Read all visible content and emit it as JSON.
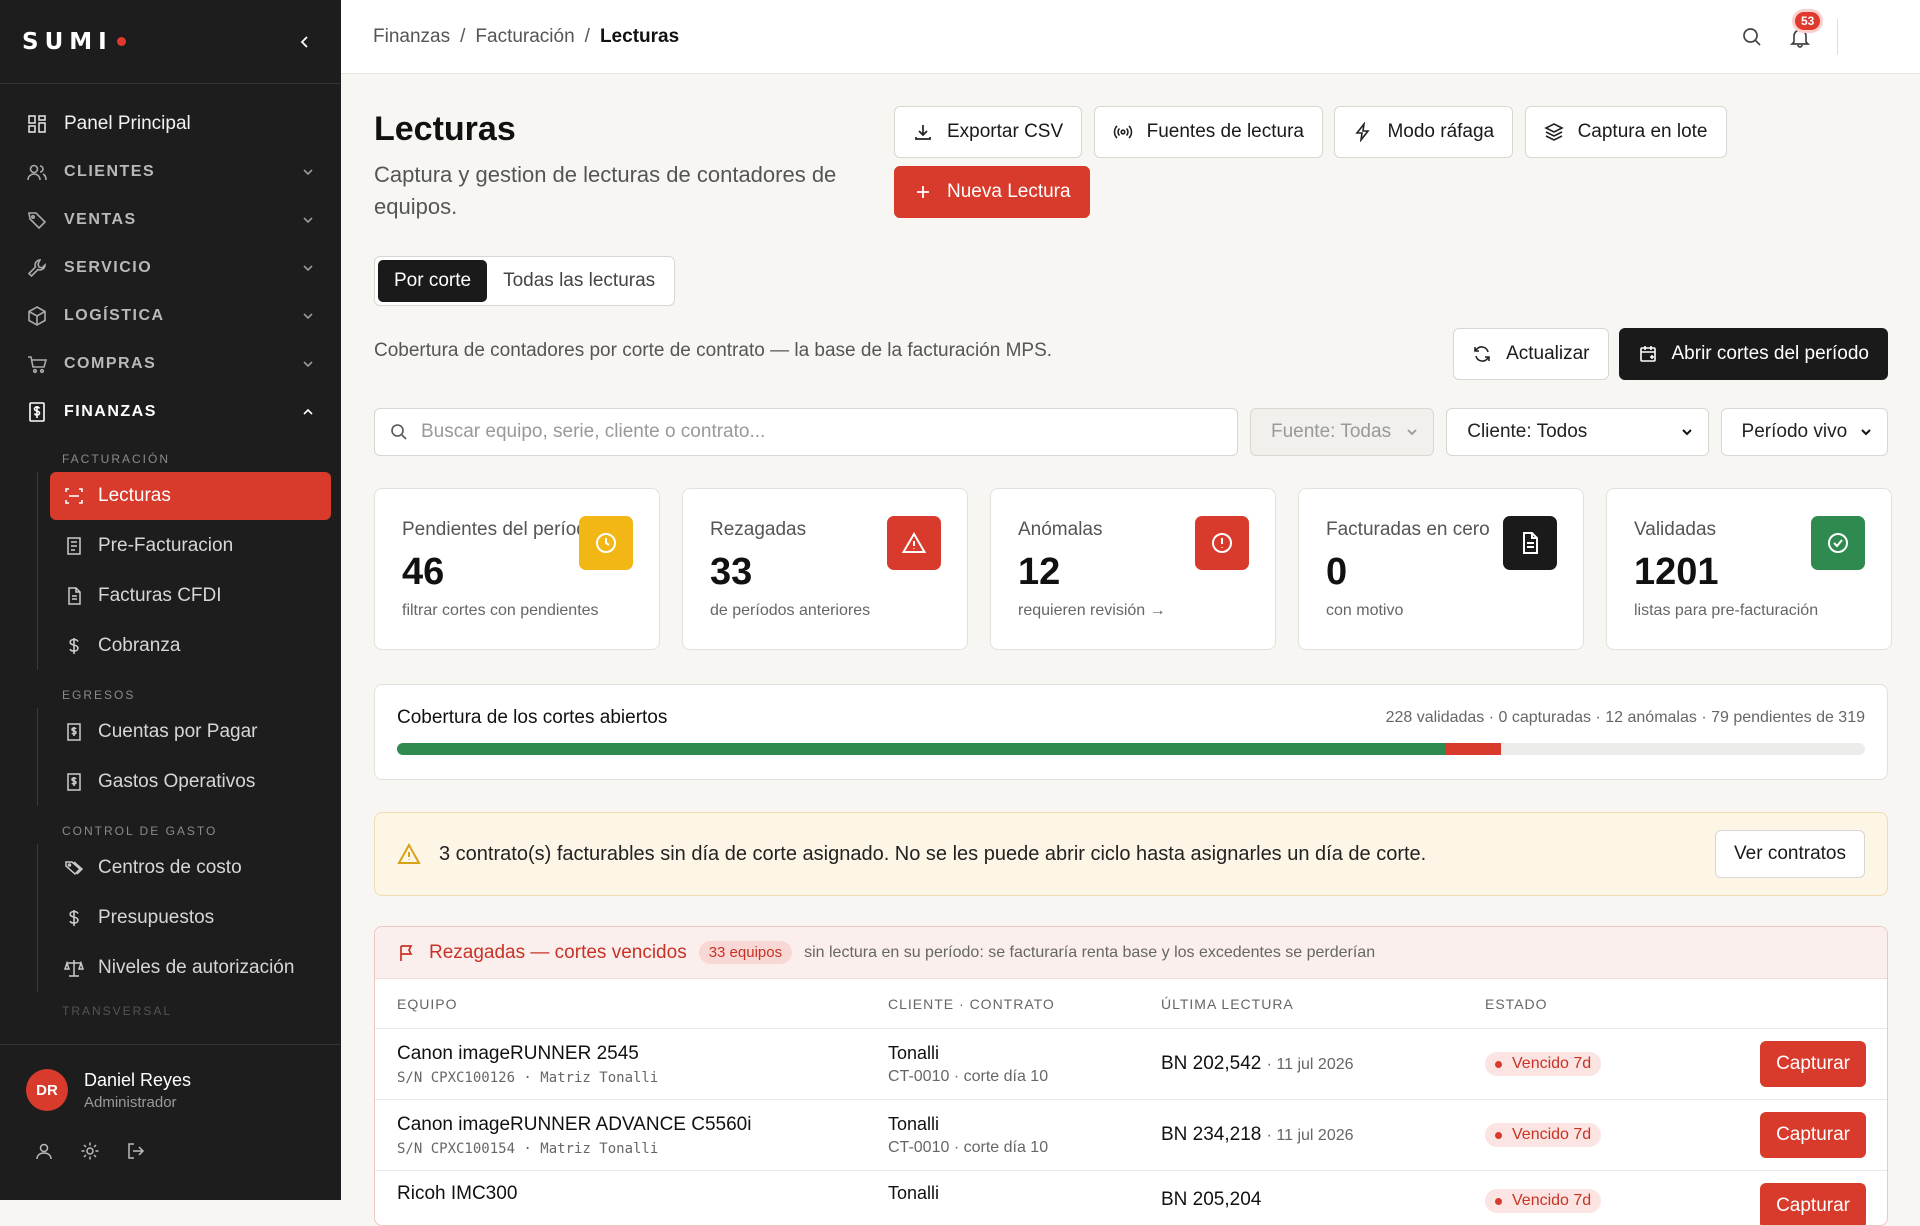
{
  "sidebar": {
    "logo": "SUMI",
    "items": {
      "panel": "Panel Principal",
      "clientes": "CLIENTES",
      "ventas": "VENTAS",
      "servicio": "SERVICIO",
      "logistica": "LOGÍSTICA",
      "compras": "COMPRAS",
      "finanzas": "FINANZAS"
    },
    "groups": {
      "facturacion": "FACTURACIÓN",
      "egresos": "EGRESOS",
      "control": "CONTROL DE GASTO",
      "next": "TRANSVERSAL"
    },
    "sub": {
      "lecturas": "Lecturas",
      "prefact": "Pre-Facturacion",
      "cfdi": "Facturas CFDI",
      "cobranza": "Cobranza",
      "cxp": "Cuentas por Pagar",
      "gastos": "Gastos Operativos",
      "centros": "Centros de costo",
      "presupuestos": "Presupuestos",
      "niveles": "Niveles de autorización"
    },
    "user": {
      "initials": "DR",
      "name": "Daniel Reyes",
      "role": "Administrador"
    }
  },
  "topbar": {
    "crumb1": "Finanzas",
    "sep": "/",
    "crumb2": "Facturación",
    "crumb3": "Lecturas",
    "notif_count": "53"
  },
  "page": {
    "title": "Lecturas",
    "subtitle": "Captura y gestion de lecturas de contadores de equipos.",
    "actions": {
      "export": "Exportar CSV",
      "fuentes": "Fuentes de lectura",
      "rafaga": "Modo ráfaga",
      "lote": "Captura en lote",
      "nueva": "Nueva Lectura"
    },
    "tabs": {
      "corte": "Por corte",
      "todas": "Todas las lecturas"
    },
    "coverage_desc": "Cobertura de contadores por corte de contrato — la base de la facturación MPS.",
    "actualizar": "Actualizar",
    "abrir": "Abrir cortes del período"
  },
  "filters": {
    "search_placeholder": "Buscar equipo, serie, cliente o contrato...",
    "fuente": "Fuente: Todas",
    "cliente": "Cliente: Todos",
    "periodo": "Período vivo"
  },
  "kpis": [
    {
      "title": "Pendientes del período",
      "value": "46",
      "note": "filtrar cortes con pendientes",
      "color": "#f2b714"
    },
    {
      "title": "Rezagadas",
      "value": "33",
      "note": "de períodos anteriores",
      "color": "#d83a2c"
    },
    {
      "title": "Anómalas",
      "value": "12",
      "note": "requieren revisión →",
      "color": "#d83a2c"
    },
    {
      "title": "Facturadas en cero",
      "value": "0",
      "note": "con motivo",
      "color": "#1a1a1a"
    },
    {
      "title": "Validadas",
      "value": "1201",
      "note": "listas para pre-facturación",
      "color": "#2e8a4f"
    }
  ],
  "coverage": {
    "title": "Cobertura de los cortes abiertos",
    "stats": "228 validadas · 0 capturadas · 12 anómalas · 79 pendientes de 319",
    "validadas": 228,
    "anomalas": 12,
    "total": 319
  },
  "alert": {
    "text": "3 contrato(s) facturables sin día de corte asignado. No se les puede abrir ciclo hasta asignarles un día de corte.",
    "button": "Ver contratos"
  },
  "late": {
    "title": "Rezagadas — cortes vencidos",
    "count": "33 equipos",
    "note": "sin lectura en su período: se facturaría renta base y los excedentes se perderían",
    "headers": {
      "equipo": "EQUIPO",
      "cliente": "CLIENTE · CONTRATO",
      "ultima": "ÚLTIMA LECTURA",
      "estado": "ESTADO"
    },
    "rows": [
      {
        "equipo": "Canon imageRUNNER 2545",
        "serie": "S/N CPXC100126 · Matriz Tonalli",
        "cliente": "Tonalli",
        "contrato": "CT-0010 · corte día 10",
        "lectura": "BN 202,542",
        "fecha": "· 11 jul 2026",
        "estado": "Vencido 7d",
        "accion": "Capturar"
      },
      {
        "equipo": "Canon imageRUNNER ADVANCE C5560i",
        "serie": "S/N CPXC100154 · Matriz Tonalli",
        "cliente": "Tonalli",
        "contrato": "CT-0010 · corte día 10",
        "lectura": "BN 234,218",
        "fecha": "· 11 jul 2026",
        "estado": "Vencido 7d",
        "accion": "Capturar"
      },
      {
        "equipo": "Ricoh IMC300",
        "serie": "",
        "cliente": "Tonalli",
        "contrato": "",
        "lectura": "BN 205,204",
        "fecha": "",
        "estado": "Vencido 7d",
        "accion": "Capturar"
      }
    ]
  }
}
